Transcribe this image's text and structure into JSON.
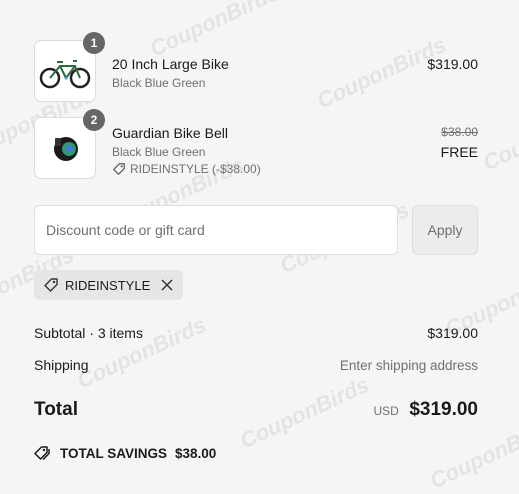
{
  "items": [
    {
      "qty": "1",
      "title": "20 Inch Large Bike",
      "variant": "Black Blue Green",
      "price": "$319.00"
    },
    {
      "qty": "2",
      "title": "Guardian Bike Bell",
      "variant": "Black Blue Green",
      "discount": "RIDEINSTYLE (-$38.00)",
      "original_price": "$38.00",
      "price": "FREE"
    }
  ],
  "discount": {
    "placeholder": "Discount code or gift card",
    "apply_label": "Apply",
    "applied_code": "RIDEINSTYLE"
  },
  "summary": {
    "subtotal_label": "Subtotal · 3 items",
    "subtotal_value": "$319.00",
    "shipping_label": "Shipping",
    "shipping_value": "Enter shipping address",
    "total_label": "Total",
    "currency": "USD",
    "total_value": "$319.00",
    "savings_label": "TOTAL SAVINGS",
    "savings_value": "$38.00"
  },
  "watermark": "CouponBirds",
  "icons": {
    "discount_tag": "tag-icon",
    "remove": "close-icon",
    "savings": "tags-icon"
  }
}
